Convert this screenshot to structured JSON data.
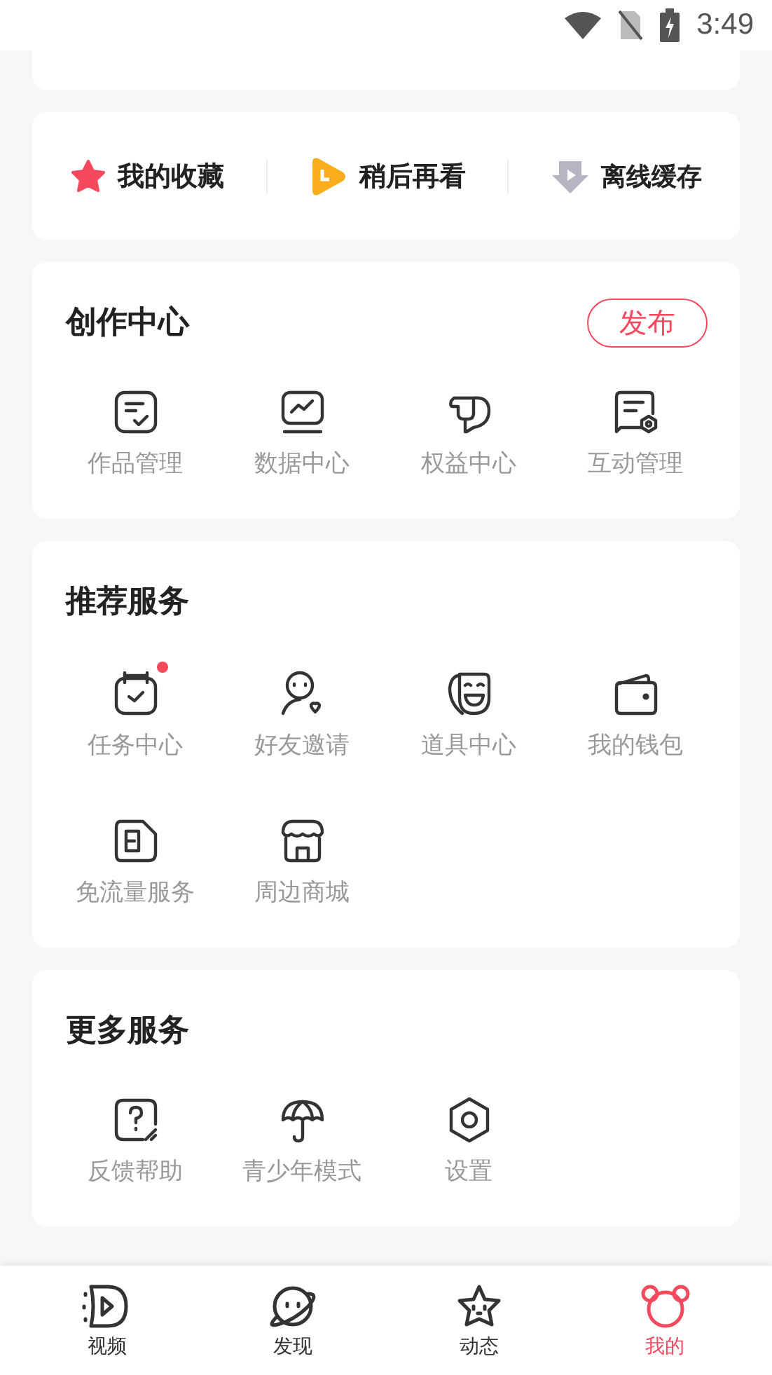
{
  "status_bar": {
    "time": "3:49"
  },
  "quick_links": [
    {
      "label": "我的收藏"
    },
    {
      "label": "稍后再看"
    },
    {
      "label": "离线缓存"
    }
  ],
  "creation_center": {
    "title": "创作中心",
    "publish_button": "发布",
    "items": [
      {
        "label": "作品管理"
      },
      {
        "label": "数据中心"
      },
      {
        "label": "权益中心"
      },
      {
        "label": "互动管理"
      }
    ]
  },
  "recommended_services": {
    "title": "推荐服务",
    "items": [
      {
        "label": "任务中心",
        "badge": true
      },
      {
        "label": "好友邀请",
        "badge": false
      },
      {
        "label": "道具中心",
        "badge": false
      },
      {
        "label": "我的钱包",
        "badge": false
      },
      {
        "label": "免流量服务",
        "badge": false
      },
      {
        "label": "周边商城",
        "badge": false
      }
    ]
  },
  "more_services": {
    "title": "更多服务",
    "items": [
      {
        "label": "反馈帮助"
      },
      {
        "label": "青少年模式"
      },
      {
        "label": "设置"
      }
    ]
  },
  "bottom_nav": [
    {
      "label": "视频",
      "selected": false
    },
    {
      "label": "发现",
      "selected": false
    },
    {
      "label": "动态",
      "selected": false
    },
    {
      "label": "我的",
      "selected": true
    }
  ]
}
